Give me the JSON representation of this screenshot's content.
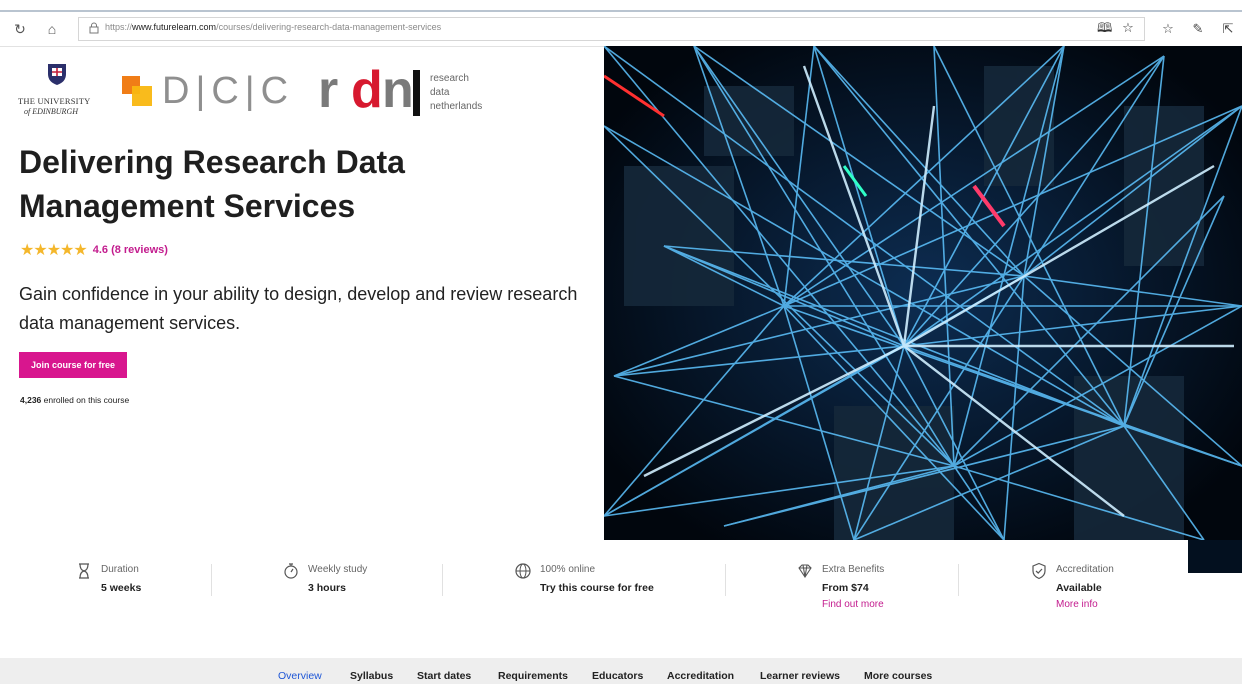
{
  "browser": {
    "url_prefix": "https://",
    "url_host": "www.futurelearn.com",
    "url_path": "/courses/delivering-research-data-management-services"
  },
  "logos": {
    "uoe_line1": "THE UNIVERSITY",
    "uoe_line2": "of EDINBURGH",
    "dcc": "D|C|C",
    "rdnl": {
      "r": "r",
      "d": "d",
      "n": "n",
      "line1": "research",
      "line2": "data",
      "line3": "netherlands"
    }
  },
  "course": {
    "title": "Delivering Research Data Management Services",
    "rating_stars": "★★★★★",
    "rating_text": "4.6 (8 reviews)",
    "rating_value": 4.6,
    "tagline": "Gain confidence in your ability to design, develop and review research data management services.",
    "join_label": "Join course for free",
    "enrolled_count": "4,236",
    "enrolled_suffix": " enrolled on this course"
  },
  "features": [
    {
      "icon": "hourglass-icon",
      "label": "Duration",
      "value": "5 weeks"
    },
    {
      "icon": "stopwatch-icon",
      "label": "Weekly study",
      "value": "3 hours"
    },
    {
      "icon": "globe-icon",
      "label": "100% online",
      "value": "Try this course for free"
    },
    {
      "icon": "diamond-icon",
      "label": "Extra Benefits",
      "value": "From $74",
      "link": "Find out more"
    },
    {
      "icon": "shield-check-icon",
      "label": "Accreditation",
      "value": "Available",
      "link": "More info"
    }
  ],
  "tabs": [
    {
      "label": "Overview",
      "active": true
    },
    {
      "label": "Syllabus"
    },
    {
      "label": "Start dates"
    },
    {
      "label": "Requirements"
    },
    {
      "label": "Educators"
    },
    {
      "label": "Accreditation"
    },
    {
      "label": "Learner reviews"
    },
    {
      "label": "More courses"
    }
  ],
  "colors": {
    "accent": "#d8168e",
    "link": "#c31c8e",
    "tab_active": "#1e56d6",
    "star": "#f4b72c"
  }
}
